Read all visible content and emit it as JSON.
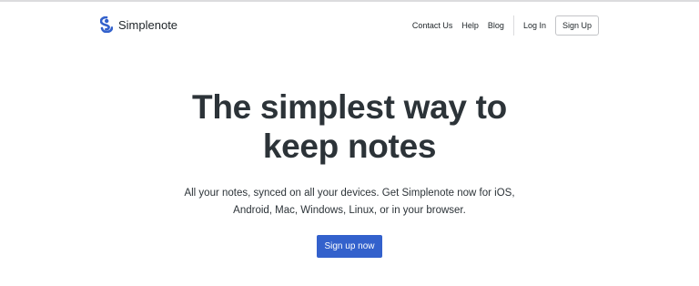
{
  "header": {
    "brand_name": "Simplenote",
    "nav": {
      "contact": "Contact Us",
      "help": "Help",
      "blog": "Blog",
      "login": "Log In",
      "signup": "Sign Up"
    }
  },
  "hero": {
    "title_line1": "The simplest way to",
    "title_line2": "keep notes",
    "subtitle_line1": "All your notes, synced on all your devices. Get Simplenote now for iOS,",
    "subtitle_line2": "Android, Mac, Windows, Linux, or in your browser.",
    "cta_label": "Sign up now"
  },
  "colors": {
    "brand": "#3361cc",
    "text": "#2c3338"
  },
  "icons": {
    "brand_logo": "simplenote-logo-icon"
  }
}
